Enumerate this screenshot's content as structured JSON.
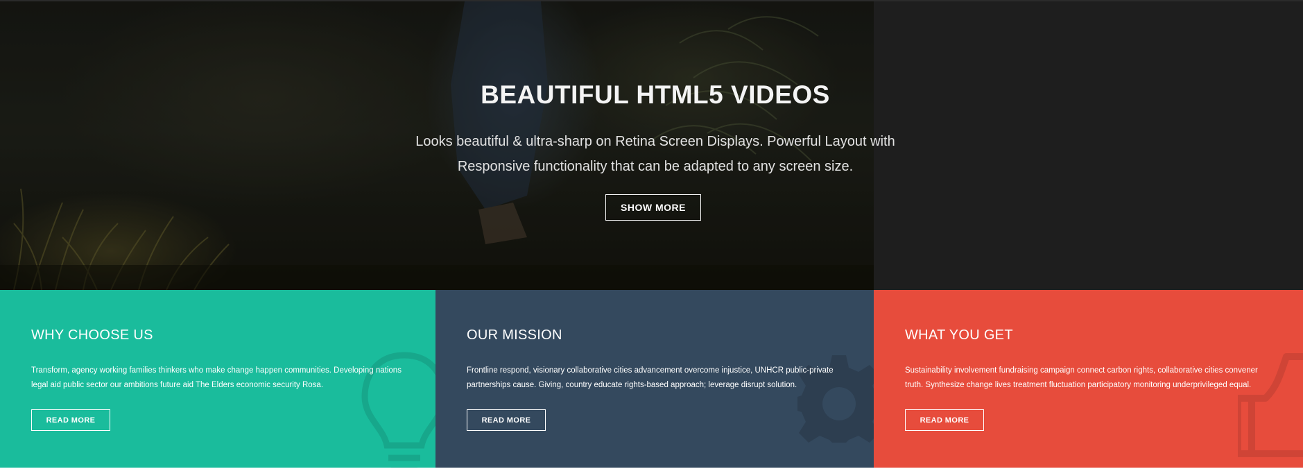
{
  "hero": {
    "title": "BEAUTIFUL HTML5 VIDEOS",
    "subtitle_line1": "Looks beautiful & ultra-sharp on Retina Screen Displays. Powerful Layout with",
    "subtitle_line2": "Responsive functionality that can be adapted to any screen size.",
    "button_label": "SHOW MORE"
  },
  "panels": [
    {
      "title": "WHY CHOOSE US",
      "text_line1": "Transform, agency working families thinkers who make change happen communities. Developing nations",
      "text_line2": "legal aid public sector our ambitions future aid The Elders economic security Rosa.",
      "button_label": "READ MORE",
      "icon": "lightbulb-icon",
      "color": "#1abc9c"
    },
    {
      "title": "OUR MISSION",
      "text_line1": "Frontline respond, visionary collaborative cities advancement overcome injustice, UNHCR public-private",
      "text_line2": "partnerships cause. Giving, country educate rights-based approach; leverage disrupt solution.",
      "button_label": "READ MORE",
      "icon": "gear-icon",
      "color": "#34495e"
    },
    {
      "title": "WHAT YOU GET",
      "text_line1": "Sustainability involvement fundraising campaign connect carbon rights, collaborative cities convener",
      "text_line2": "truth. Synthesize change lives treatment fluctuation participatory monitoring underprivileged equal.",
      "button_label": "READ MORE",
      "icon": "thumbs-up-icon",
      "color": "#e74c3c"
    }
  ]
}
